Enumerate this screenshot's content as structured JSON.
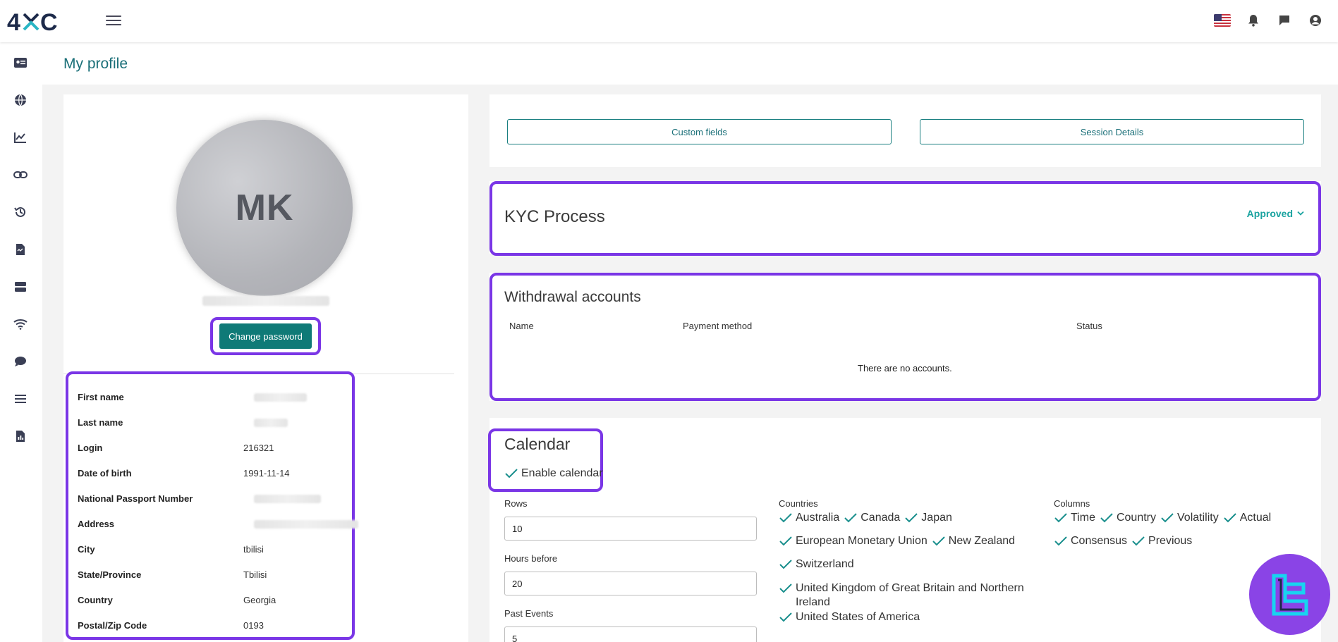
{
  "brand": {
    "logo_text": "4XC"
  },
  "header": {
    "page_title": "My profile"
  },
  "profile": {
    "initials": "MK",
    "change_password_label": "Change password",
    "fields": [
      {
        "label": "First name",
        "value": ""
      },
      {
        "label": "Last name",
        "value": ""
      },
      {
        "label": "Login",
        "value": "216321"
      },
      {
        "label": "Date of birth",
        "value": "1991-11-14"
      },
      {
        "label": "National Passport Number",
        "value": ""
      },
      {
        "label": "Address",
        "value": ""
      },
      {
        "label": "City",
        "value": "tbilisi"
      },
      {
        "label": "State/Province",
        "value": "Tbilisi"
      },
      {
        "label": "Country",
        "value": "Georgia"
      },
      {
        "label": "Postal/Zip Code",
        "value": "0193"
      }
    ]
  },
  "actions": {
    "custom_fields_label": "Custom fields",
    "session_details_label": "Session Details"
  },
  "kyc": {
    "title": "KYC Process",
    "status": "Approved"
  },
  "withdrawal": {
    "title": "Withdrawal accounts",
    "columns": [
      "Name",
      "Payment method",
      "Status"
    ],
    "empty_text": "There are no accounts."
  },
  "calendar": {
    "title": "Calendar",
    "enable_label": "Enable calendar",
    "rows_label": "Rows",
    "rows_value": "10",
    "hours_before_label": "Hours before",
    "hours_before_value": "20",
    "past_events_label": "Past Events",
    "past_events_value": "5",
    "countries_label": "Countries",
    "countries": [
      "Australia",
      "Canada",
      "Japan",
      "European Monetary Union",
      "New Zealand",
      "Switzerland",
      "United Kingdom of Great Britain and Northern Ireland",
      "United States of America"
    ],
    "columns_label": "Columns",
    "columns": [
      "Time",
      "Country",
      "Volatility",
      "Actual",
      "Consensus",
      "Previous"
    ]
  },
  "colors": {
    "accent": "#0f7a77",
    "highlight": "#7a36e6",
    "approved": "#1aa3a0"
  }
}
